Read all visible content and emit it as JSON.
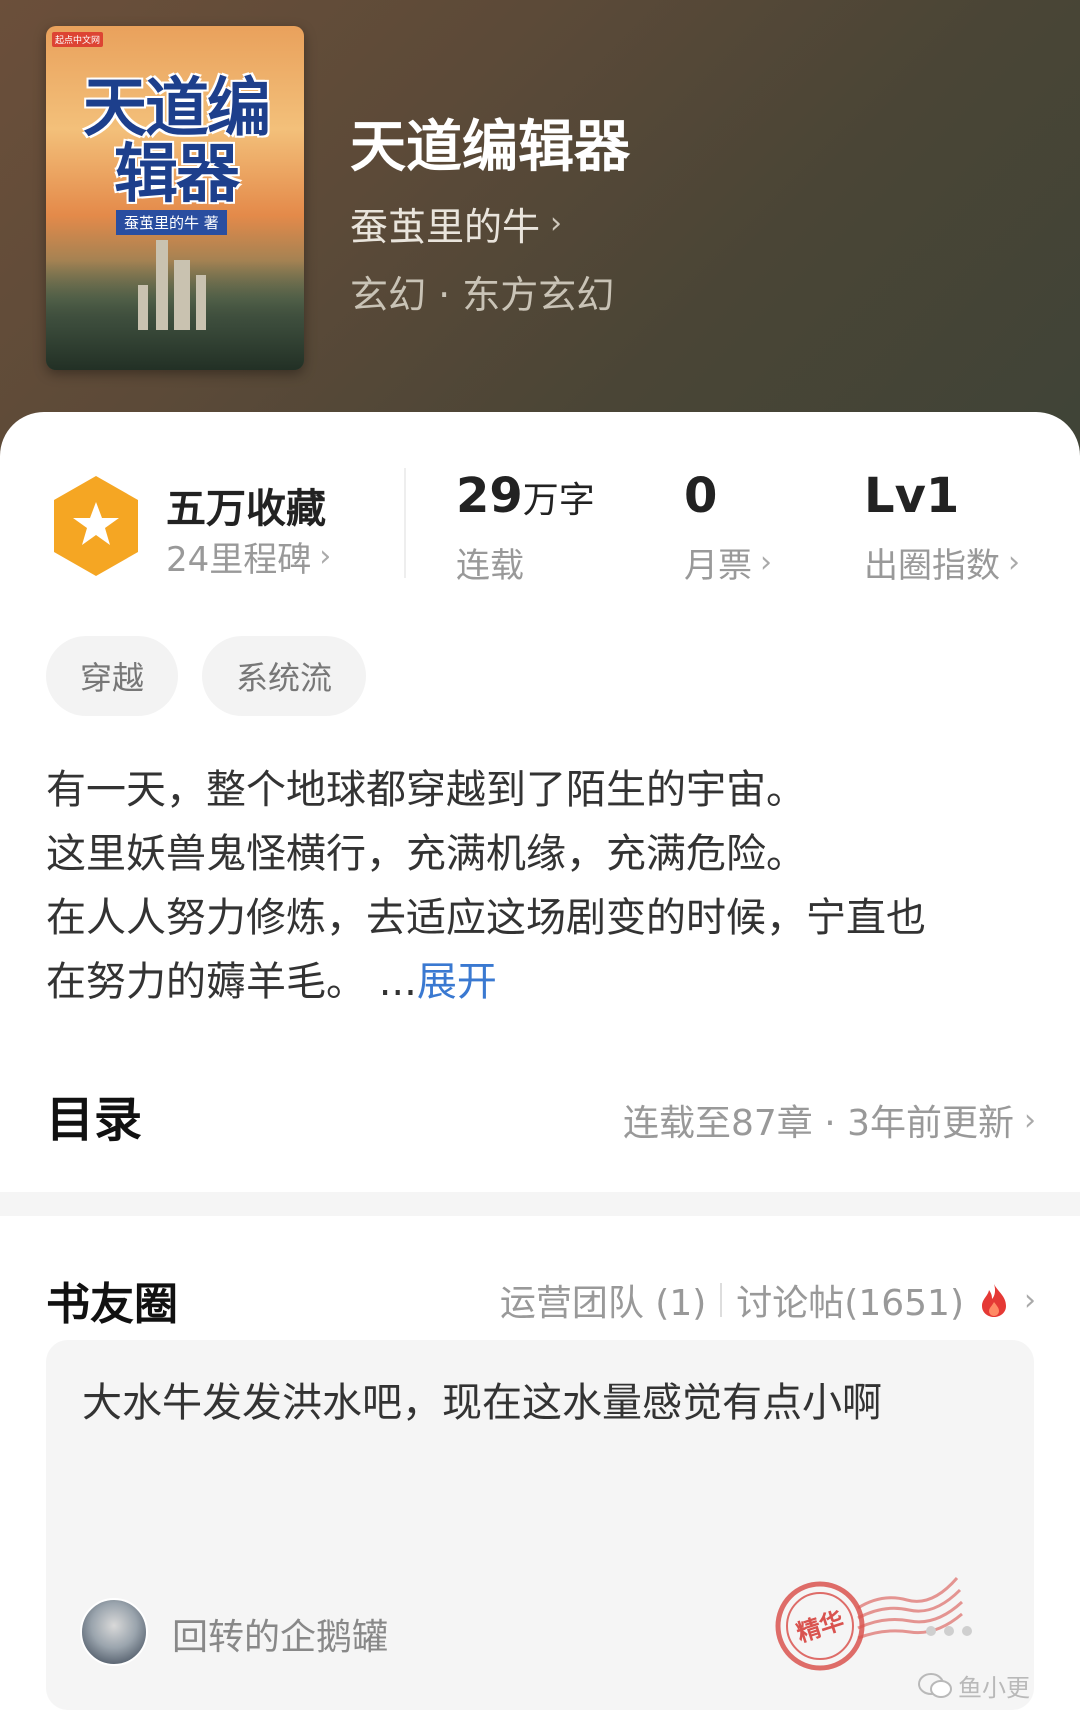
{
  "book": {
    "title": "天道编辑器",
    "author": "蚕茧里的牛",
    "category": "玄幻 · 东方玄幻"
  },
  "cover": {
    "title": "天道编辑器",
    "author_label": "蚕茧里的牛 著",
    "publisher": "起点中文网"
  },
  "stats": {
    "favorites": "五万收藏",
    "milestones": "24里程碑",
    "word_count_num": "29",
    "word_count_unit": "万字",
    "status": "连载",
    "monthly_tickets": "0",
    "monthly_tickets_label": "月票",
    "level": "Lv1",
    "level_label": "出圈指数"
  },
  "tags": [
    "穿越",
    "系统流"
  ],
  "description": {
    "lines": [
      "有一天，整个地球都穿越到了陌生的宇宙。",
      "这里妖兽鬼怪横行，充满机缘，充满危险。",
      "在人人努力修炼，去适应这场剧变的时候，宁直也",
      "在努力的薅羊毛。 ..."
    ],
    "expand_label": "展开"
  },
  "toc": {
    "heading": "目录",
    "meta": "连载至87章 · 3年前更新"
  },
  "circle": {
    "heading": "书友圈",
    "ops_team": "运营团队 (1)",
    "discussion": "讨论帖(1651)",
    "post_text": "大水牛发发洪水吧，现在这水量感觉有点小啊",
    "post_user": "回转的企鹅罐",
    "stamp_label": "精华"
  },
  "watermark": "鱼小更",
  "colors": {
    "accent_link": "#3a79d1",
    "badge_orange": "#f5a623",
    "fire_red": "#e53935",
    "stamp_red": "#d9534f"
  }
}
